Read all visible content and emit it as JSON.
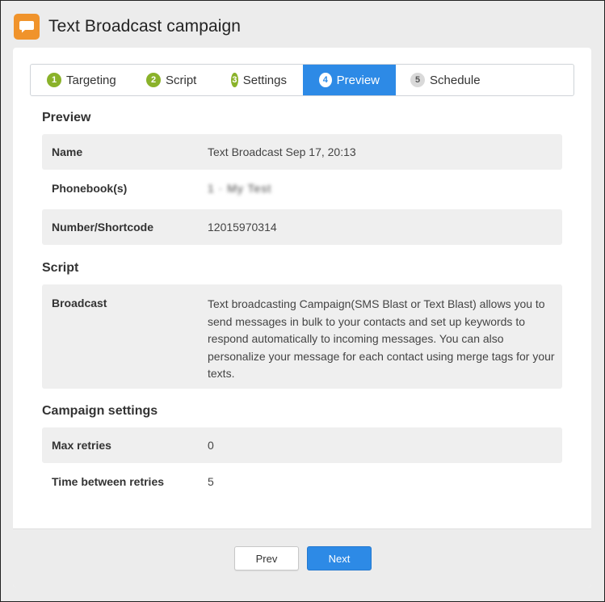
{
  "header": {
    "title": "Text Broadcast campaign",
    "icon": "chat-bubble-icon",
    "icon_color": "#f0932b"
  },
  "tabs": [
    {
      "num": "1",
      "label": "Targeting",
      "state": "done"
    },
    {
      "num": "2",
      "label": "Script",
      "state": "done"
    },
    {
      "num": "3",
      "label": "Settings",
      "state": "done"
    },
    {
      "num": "4",
      "label": "Preview",
      "state": "active"
    },
    {
      "num": "5",
      "label": "Schedule",
      "state": "pending"
    }
  ],
  "preview": {
    "title": "Preview",
    "rows": [
      {
        "label": "Name",
        "value": "Text Broadcast Sep 17, 20:13"
      },
      {
        "label": "Phonebook(s)",
        "value": "1 · My Test"
      },
      {
        "label": "Number/Shortcode",
        "value": "12015970314"
      }
    ]
  },
  "script": {
    "title": "Script",
    "label": "Broadcast",
    "value": "Text broadcasting Campaign(SMS Blast or Text Blast) allows you to send messages in bulk to your contacts and set up keywords to respond automatically to incoming messages. You can also personalize your message for each contact using merge tags for your texts."
  },
  "settings": {
    "title": "Campaign settings",
    "rows": [
      {
        "label": "Max retries",
        "value": "0"
      },
      {
        "label": "Time between retries",
        "value": "5"
      }
    ]
  },
  "footer": {
    "prev_label": "Prev",
    "next_label": "Next"
  },
  "colors": {
    "accent": "#2d8ae6",
    "done": "#8ab22a",
    "pending": "#d9d9d9"
  }
}
